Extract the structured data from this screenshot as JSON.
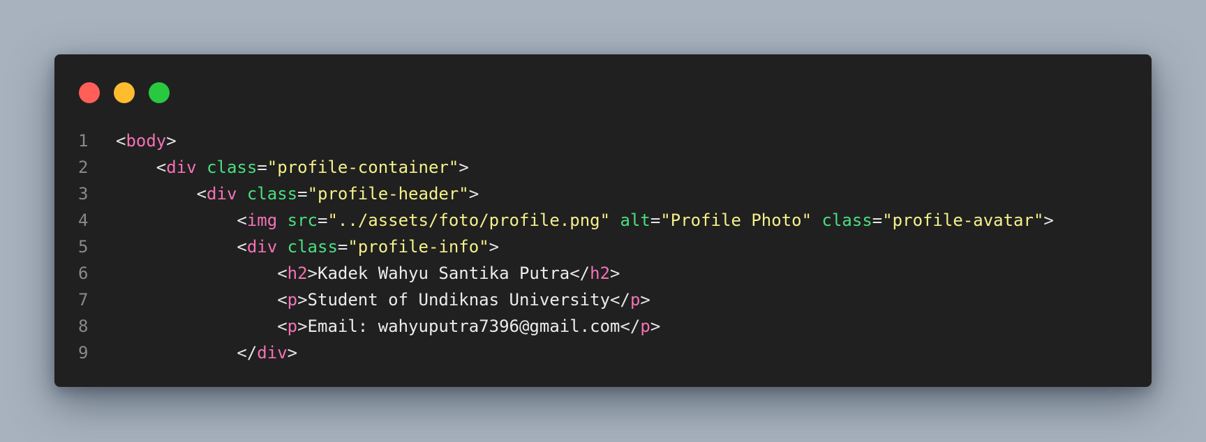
{
  "window": {
    "controls": [
      "close",
      "minimize",
      "maximize"
    ],
    "colors": {
      "close": "#ff5f57",
      "minimize": "#febc2e",
      "maximize": "#28c840"
    }
  },
  "code": {
    "language": "html",
    "lines": [
      {
        "number": "1",
        "indent": "",
        "tokens": [
          {
            "t": "p",
            "v": "<"
          },
          {
            "t": "tag",
            "v": "body"
          },
          {
            "t": "p",
            "v": ">"
          }
        ]
      },
      {
        "number": "2",
        "indent": "    ",
        "tokens": [
          {
            "t": "p",
            "v": "<"
          },
          {
            "t": "tag",
            "v": "div"
          },
          {
            "t": "p",
            "v": " "
          },
          {
            "t": "attr",
            "v": "class"
          },
          {
            "t": "p",
            "v": "="
          },
          {
            "t": "str",
            "v": "\"profile-container\""
          },
          {
            "t": "p",
            "v": ">"
          }
        ]
      },
      {
        "number": "3",
        "indent": "        ",
        "tokens": [
          {
            "t": "p",
            "v": "<"
          },
          {
            "t": "tag",
            "v": "div"
          },
          {
            "t": "p",
            "v": " "
          },
          {
            "t": "attr",
            "v": "class"
          },
          {
            "t": "p",
            "v": "="
          },
          {
            "t": "str",
            "v": "\"profile-header\""
          },
          {
            "t": "p",
            "v": ">"
          }
        ]
      },
      {
        "number": "4",
        "indent": "            ",
        "tokens": [
          {
            "t": "p",
            "v": "<"
          },
          {
            "t": "tag",
            "v": "img"
          },
          {
            "t": "p",
            "v": " "
          },
          {
            "t": "attr",
            "v": "src"
          },
          {
            "t": "p",
            "v": "="
          },
          {
            "t": "str",
            "v": "\"../assets/foto/profile.png\""
          },
          {
            "t": "p",
            "v": " "
          },
          {
            "t": "attr",
            "v": "alt"
          },
          {
            "t": "p",
            "v": "="
          },
          {
            "t": "str",
            "v": "\"Profile Photo\""
          },
          {
            "t": "p",
            "v": " "
          },
          {
            "t": "attr",
            "v": "class"
          },
          {
            "t": "p",
            "v": "="
          },
          {
            "t": "str",
            "v": "\"profile-avatar\""
          },
          {
            "t": "p",
            "v": ">"
          }
        ]
      },
      {
        "number": "5",
        "indent": "            ",
        "tokens": [
          {
            "t": "p",
            "v": "<"
          },
          {
            "t": "tag",
            "v": "div"
          },
          {
            "t": "p",
            "v": " "
          },
          {
            "t": "attr",
            "v": "class"
          },
          {
            "t": "p",
            "v": "="
          },
          {
            "t": "str",
            "v": "\"profile-info\""
          },
          {
            "t": "p",
            "v": ">"
          }
        ]
      },
      {
        "number": "6",
        "indent": "                ",
        "tokens": [
          {
            "t": "p",
            "v": "<"
          },
          {
            "t": "tag",
            "v": "h2"
          },
          {
            "t": "p",
            "v": ">"
          },
          {
            "t": "txt",
            "v": "Kadek Wahyu Santika Putra"
          },
          {
            "t": "p",
            "v": "</"
          },
          {
            "t": "tag",
            "v": "h2"
          },
          {
            "t": "p",
            "v": ">"
          }
        ]
      },
      {
        "number": "7",
        "indent": "                ",
        "tokens": [
          {
            "t": "p",
            "v": "<"
          },
          {
            "t": "tag",
            "v": "p"
          },
          {
            "t": "p",
            "v": ">"
          },
          {
            "t": "txt",
            "v": "Student of Undiknas University"
          },
          {
            "t": "p",
            "v": "</"
          },
          {
            "t": "tag",
            "v": "p"
          },
          {
            "t": "p",
            "v": ">"
          }
        ]
      },
      {
        "number": "8",
        "indent": "                ",
        "tokens": [
          {
            "t": "p",
            "v": "<"
          },
          {
            "t": "tag",
            "v": "p"
          },
          {
            "t": "p",
            "v": ">"
          },
          {
            "t": "txt",
            "v": "Email: wahyuputra7396@gmail.com"
          },
          {
            "t": "p",
            "v": "</"
          },
          {
            "t": "tag",
            "v": "p"
          },
          {
            "t": "p",
            "v": ">"
          }
        ]
      },
      {
        "number": "9",
        "indent": "            ",
        "tokens": [
          {
            "t": "p",
            "v": "</"
          },
          {
            "t": "tag",
            "v": "div"
          },
          {
            "t": "p",
            "v": ">"
          }
        ]
      }
    ]
  },
  "theme": {
    "background": "#202020",
    "tag": "#f472b6",
    "attribute": "#4ade80",
    "string": "#f5f08a",
    "punctuation": "#e6e6e6",
    "line_number": "#8a8a8a"
  }
}
